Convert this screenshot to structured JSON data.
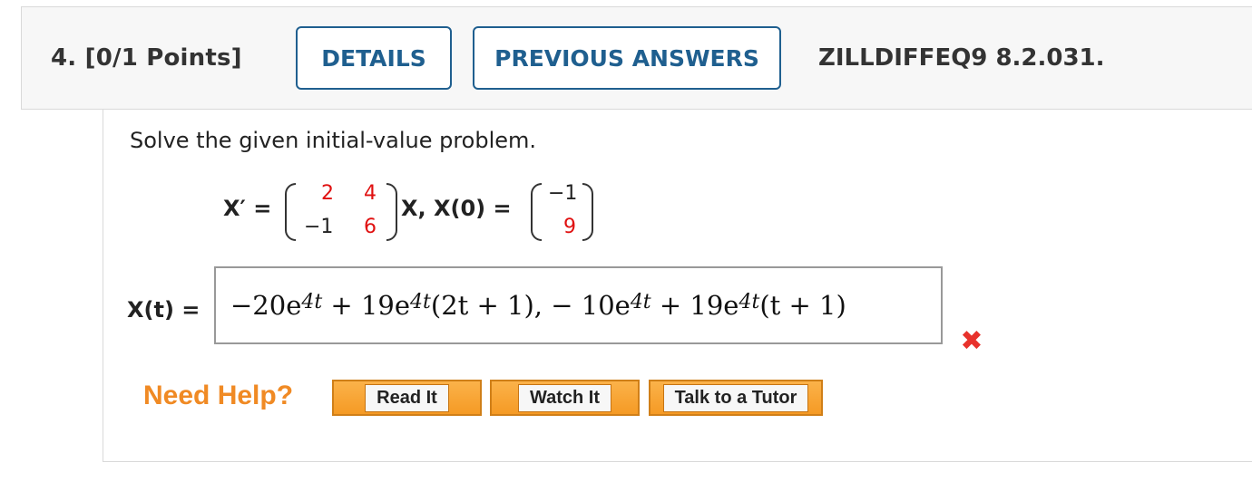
{
  "header": {
    "question_number": "4. [0/1 Points]",
    "details_label": "DETAILS",
    "previous_answers_label": "PREVIOUS ANSWERS",
    "problem_code": "ZILLDIFFEQ9 8.2.031."
  },
  "problem": {
    "prompt": "Solve the given initial-value problem.",
    "lhs": "X′ =",
    "matrix": [
      [
        "2",
        "4"
      ],
      [
        "−1",
        "6"
      ]
    ],
    "after_matrix": "X, X(0) =",
    "initial_vector": [
      "−1",
      "9"
    ]
  },
  "answer": {
    "label": "X(t) =",
    "parts": [
      {
        "text": "−20e",
        "exp": "4t"
      },
      {
        "text": " + 19e",
        "exp": "4t"
      },
      {
        "text": "(2t + 1), − 10e",
        "exp": "4t"
      },
      {
        "text": " + 19e",
        "exp": "4t"
      },
      {
        "text": "(t + 1)",
        "exp": ""
      }
    ],
    "status_icon": "wrong-x-icon",
    "status_color": "#e8322c"
  },
  "help": {
    "label": "Need Help?",
    "buttons": [
      "Read It",
      "Watch It",
      "Talk to a Tutor"
    ]
  }
}
